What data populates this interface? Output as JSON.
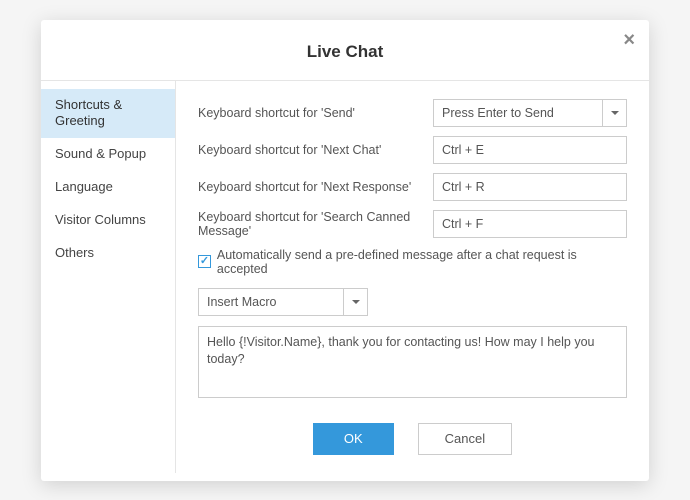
{
  "modal": {
    "title": "Live Chat",
    "close_label": "×"
  },
  "sidebar": {
    "items": [
      {
        "label": "Shortcuts & Greeting",
        "active": true
      },
      {
        "label": "Sound & Popup",
        "active": false
      },
      {
        "label": "Language",
        "active": false
      },
      {
        "label": "Visitor Columns",
        "active": false
      },
      {
        "label": "Others",
        "active": false
      }
    ]
  },
  "form": {
    "rows": [
      {
        "label": "Keyboard shortcut for 'Send'",
        "type": "select",
        "value": "Press Enter to Send"
      },
      {
        "label": "Keyboard shortcut for 'Next Chat'",
        "type": "text",
        "value": "Ctrl + E"
      },
      {
        "label": "Keyboard shortcut for 'Next Response'",
        "type": "text",
        "value": "Ctrl + R"
      },
      {
        "label": "Keyboard shortcut for 'Search Canned Message'",
        "type": "text",
        "value": "Ctrl + F"
      }
    ],
    "auto_send": {
      "checked": true,
      "label": "Automatically send a pre-defined message after a chat request is accepted"
    },
    "macro_select": {
      "value": "Insert Macro"
    },
    "greeting_text": "Hello {!Visitor.Name}, thank you for contacting us! How may I help you today?"
  },
  "buttons": {
    "ok": "OK",
    "cancel": "Cancel"
  }
}
